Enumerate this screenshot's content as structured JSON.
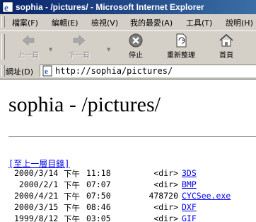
{
  "window": {
    "title": "sophia - /pictures/ - Microsoft Internet Explorer"
  },
  "menu": [
    {
      "label": "檔案(F)"
    },
    {
      "label": "編輯(E)"
    },
    {
      "label": "檢視(V)"
    },
    {
      "label": "我的最愛(A)"
    },
    {
      "label": "工具(T)"
    },
    {
      "label": "說明(H)"
    }
  ],
  "toolbar": {
    "back": "上一頁",
    "forward": "下一頁",
    "stop": "停止",
    "refresh": "重新整理",
    "home": "首頁"
  },
  "address": {
    "label": "網址(D)",
    "url": "http://sophia/pictures/"
  },
  "page": {
    "heading": "sophia - /pictures/",
    "parent_link": "[至上一層目錄]",
    "files": [
      {
        "date": "2000/3/14",
        "ampm": "下午",
        "time": "11:18",
        "size": "<dir>",
        "name": "3DS"
      },
      {
        "date": " 2000/2/1",
        "ampm": "下午",
        "time": "07:07",
        "size": "<dir>",
        "name": "BMP"
      },
      {
        "date": "2000/4/21",
        "ampm": "下午",
        "time": "07:50",
        "size": "478720",
        "name": "CYCSee.exe"
      },
      {
        "date": "2000/3/15",
        "ampm": "下午",
        "time": "08:46",
        "size": "<dir>",
        "name": "DXF"
      },
      {
        "date": "1999/8/12",
        "ampm": "下午",
        "time": "03:05",
        "size": "<dir>",
        "name": "GIF"
      }
    ]
  },
  "colors": {
    "titlebar_start": "#0a246a",
    "titlebar_end": "#3a6ea5",
    "link": "#0000ee",
    "chrome": "#d4d0c8"
  }
}
